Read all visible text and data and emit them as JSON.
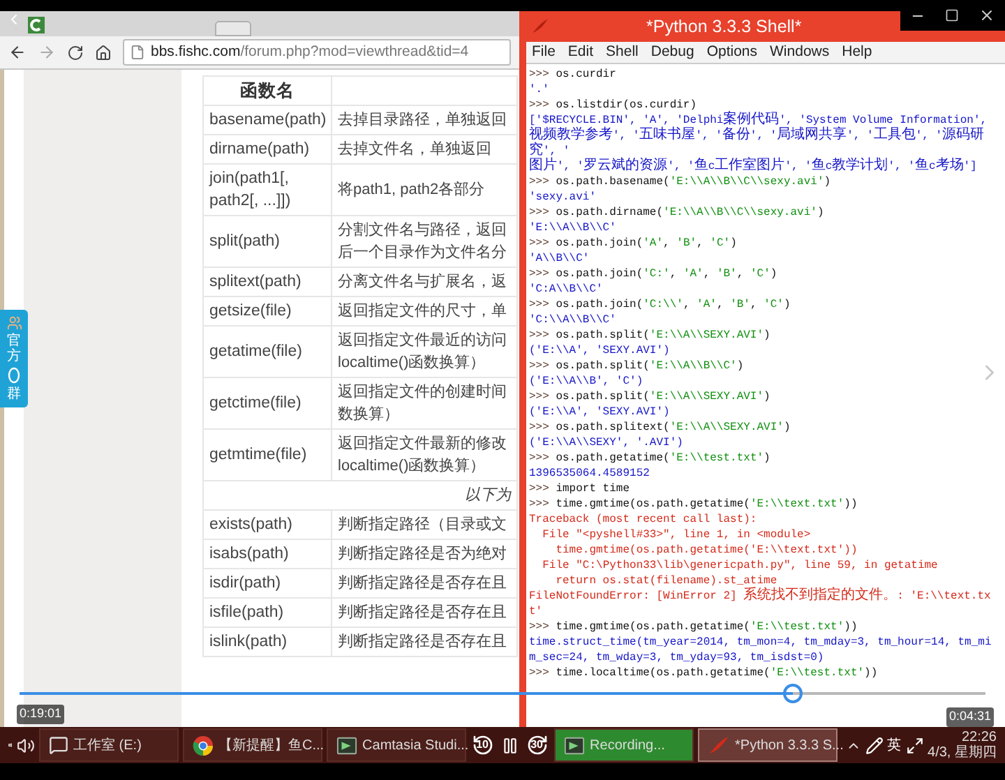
{
  "browser": {
    "url_host": "bbs.fishc.com",
    "url_path": "/forum.php?mod=viewthread&tid=4",
    "side_widget": {
      "label_top": "官方",
      "label_bottom": "群"
    },
    "table": {
      "columns": [
        "函数名"
      ],
      "rows": [
        {
          "kind": "function",
          "name": "basename(path)",
          "description": "去掉目录路径，单独返回"
        },
        {
          "kind": "function",
          "name": "dirname(path)",
          "description": "去掉文件名，单独返回"
        },
        {
          "kind": "function",
          "name": "join(path1[,\npath2[, ...]])",
          "description": "将path1, path2各部分"
        },
        {
          "kind": "function",
          "name": "split(path)",
          "description": "分割文件名与路径，返回",
          "description_2": "后一个目录作为文件名分"
        },
        {
          "kind": "function",
          "name": "splitext(path)",
          "description": "分离文件名与扩展名，返"
        },
        {
          "kind": "function",
          "name": "getsize(file)",
          "description": "返回指定文件的尺寸，单"
        },
        {
          "kind": "function",
          "name": "getatime(file)",
          "description": "返回指定文件最近的访问",
          "description_2": "localtime()函数换算）"
        },
        {
          "kind": "function",
          "name": "getctime(file)",
          "description": "返回指定文件的创建时间",
          "description_2": "数换算）"
        },
        {
          "kind": "function",
          "name": "getmtime(file)",
          "description": "返回指定文件最新的修改",
          "description_2": "localtime()函数换算）"
        },
        {
          "kind": "section",
          "label": "以下为"
        },
        {
          "kind": "function",
          "name": "exists(path)",
          "description": "判断指定路径（目录或文"
        },
        {
          "kind": "function",
          "name": "isabs(path)",
          "description": "判断指定路径是否为绝对"
        },
        {
          "kind": "function",
          "name": "isdir(path)",
          "description": "判断指定路径是否存在且"
        },
        {
          "kind": "function",
          "name": "isfile(path)",
          "description": "判断指定路径是否存在且"
        },
        {
          "kind": "function",
          "name": "islink(path)",
          "description": "判断指定路径是否存在且"
        }
      ]
    }
  },
  "shell": {
    "title": "*Python 3.3.3 Shell*",
    "menu": [
      "File",
      "Edit",
      "Shell",
      "Debug",
      "Options",
      "Windows",
      "Help"
    ],
    "lines": [
      {
        "kind": "input",
        "text": ">>> os.curdir"
      },
      {
        "kind": "output",
        "text": "'.'"
      },
      {
        "kind": "input",
        "text": ">>> os.listdir(os.curdir)"
      },
      {
        "kind": "output",
        "text": "['$RECYCLE.BIN', 'A', 'Delphi案例代码', 'System Volume Information',"
      },
      {
        "kind": "output",
        "text": "视频教学参考', '五味书屋', '备份', '局域网共享', '工具包', '源码研究', '"
      },
      {
        "kind": "output",
        "text": "图片', '罗云斌的资源', '鱼c工作室图片', '鱼c教学计划', '鱼c考场']"
      },
      {
        "kind": "input",
        "text": ">>> os.path.basename('E:\\\\A\\\\B\\\\C\\\\sexy.avi')"
      },
      {
        "kind": "output",
        "text": "'sexy.avi'"
      },
      {
        "kind": "input",
        "text": ">>> os.path.dirname('E:\\\\A\\\\B\\\\C\\\\sexy.avi')"
      },
      {
        "kind": "output",
        "text": "'E:\\\\A\\\\B\\\\C'"
      },
      {
        "kind": "input",
        "text": ">>> os.path.join('A', 'B', 'C')"
      },
      {
        "kind": "output",
        "text": "'A\\\\B\\\\C'"
      },
      {
        "kind": "input",
        "text": ">>> os.path.join('C:', 'A', 'B', 'C')"
      },
      {
        "kind": "output",
        "text": "'C:A\\\\B\\\\C'"
      },
      {
        "kind": "input",
        "text": ">>> os.path.join('C:\\\\', 'A', 'B', 'C')"
      },
      {
        "kind": "output",
        "text": "'C:\\\\A\\\\B\\\\C'"
      },
      {
        "kind": "input",
        "text": ">>> os.path.split('E:\\\\A\\\\SEXY.AVI')"
      },
      {
        "kind": "output",
        "text": "('E:\\\\A', 'SEXY.AVI')"
      },
      {
        "kind": "input",
        "text": ">>> os.path.split('E:\\\\A\\\\B\\\\C')"
      },
      {
        "kind": "output",
        "text": "('E:\\\\A\\\\B', 'C')"
      },
      {
        "kind": "input",
        "text": ">>> os.path.split('E:\\\\A\\\\SEXY.AVI')"
      },
      {
        "kind": "output",
        "text": "('E:\\\\A', 'SEXY.AVI')"
      },
      {
        "kind": "input",
        "text": ">>> os.path.splitext('E:\\\\A\\\\SEXY.AVI')"
      },
      {
        "kind": "output",
        "text": "('E:\\\\A\\\\SEXY', '.AVI')"
      },
      {
        "kind": "input",
        "text": ">>> os.path.getatime('E:\\\\test.txt')"
      },
      {
        "kind": "output",
        "text": "1396535064.4589152"
      },
      {
        "kind": "input",
        "text": ">>> import time"
      },
      {
        "kind": "input",
        "text": ">>> time.gmtime(os.path.getatime('E:\\\\text.txt'))"
      },
      {
        "kind": "error",
        "text": "Traceback (most recent call last):"
      },
      {
        "kind": "error",
        "text": "  File \"<pyshell#33>\", line 1, in <module>"
      },
      {
        "kind": "error",
        "text": "    time.gmtime(os.path.getatime('E:\\\\text.txt'))"
      },
      {
        "kind": "error",
        "text": "  File \"C:\\Python33\\lib\\genericpath.py\", line 59, in getatime"
      },
      {
        "kind": "error",
        "text": "    return os.stat(filename).st_atime"
      },
      {
        "kind": "error",
        "text": "FileNotFoundError: [WinError 2] 系统找不到指定的文件。: 'E:\\\\text.txt'"
      },
      {
        "kind": "input",
        "text": ">>> time.gmtime(os.path.getatime('E:\\\\test.txt'))"
      },
      {
        "kind": "output",
        "text": "time.struct_time(tm_year=2014, tm_mon=4, tm_mday=3, tm_hour=14, tm_mi"
      },
      {
        "kind": "output",
        "text": "m_sec=24, tm_wday=3, tm_yday=93, tm_isdst=0)"
      },
      {
        "kind": "input",
        "text": ">>> time.localtime(os.path.getatime('E:\\\\test.txt'))"
      }
    ]
  },
  "player": {
    "elapsed": "0:19:01",
    "remaining": "0:04:31",
    "level": 0.8,
    "rewind": "10",
    "forward": "30"
  },
  "taskbar": {
    "items": [
      {
        "kind": "explorer",
        "label": "工作室 (E:)",
        "selected": false
      },
      {
        "kind": "chrome",
        "label": "【新提醒】鱼C...",
        "selected": false
      },
      {
        "kind": "camtasia",
        "label": "Camtasia Studi...",
        "selected": false
      },
      {
        "kind": "recorder",
        "label": "Recording...",
        "selected": false
      },
      {
        "kind": "tk",
        "label": "*Python 3.3.3 S...",
        "selected": true
      }
    ],
    "ime": "英",
    "time": "22:26",
    "date": "4/3, 星期四"
  }
}
